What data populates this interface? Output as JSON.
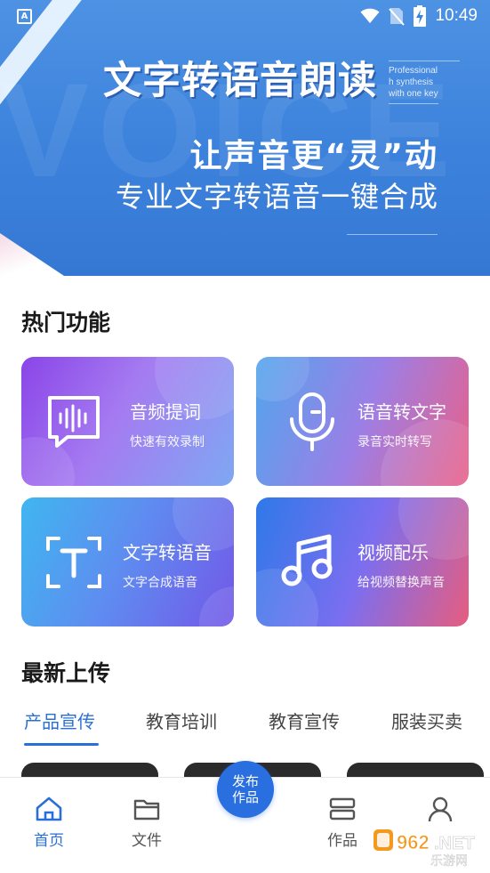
{
  "status_bar": {
    "time": "10:49",
    "app_badge": "A",
    "icons": [
      "wifi-icon",
      "no-sim-icon",
      "battery-charging-icon"
    ]
  },
  "banner": {
    "title": "文字转语音朗读",
    "english_lines": [
      "Professional",
      "h synthesis",
      "with one key"
    ],
    "watermark": "VOICE",
    "slogan": "让声音更“灵”动",
    "subtitle": "专业文字转语音一键合成"
  },
  "hot_features": {
    "heading": "热门功能",
    "cards": [
      {
        "title": "音频提词",
        "subtitle": "快速有效录制",
        "icon": "audio-waveform-icon"
      },
      {
        "title": "语音转文字",
        "subtitle": "录音实时转写",
        "icon": "microphone-icon"
      },
      {
        "title": "文字转语音",
        "subtitle": "文字合成语音",
        "icon": "text-scan-icon"
      },
      {
        "title": "视频配乐",
        "subtitle": "给视频替换声音",
        "icon": "music-note-icon"
      }
    ]
  },
  "latest": {
    "heading": "最新上传",
    "tabs": [
      "产品宣传",
      "教育培训",
      "教育宣传",
      "服装买卖"
    ],
    "active_tab": 0
  },
  "bottom_nav": {
    "items": [
      {
        "label": "首页",
        "icon": "home-icon",
        "active": true
      },
      {
        "label": "文件",
        "icon": "folder-icon",
        "active": false
      },
      {
        "label": "作品",
        "icon": "works-icon",
        "active": false
      },
      {
        "label": "",
        "icon": "profile-icon",
        "active": false
      }
    ],
    "publish_label": "发布作品"
  },
  "watermark_logo": {
    "text": "962.NET",
    "subtext": "乐游网"
  },
  "colors": {
    "accent": "#2a6fd9",
    "banner": "#3c82dc",
    "publish": "#2a6fe0"
  }
}
